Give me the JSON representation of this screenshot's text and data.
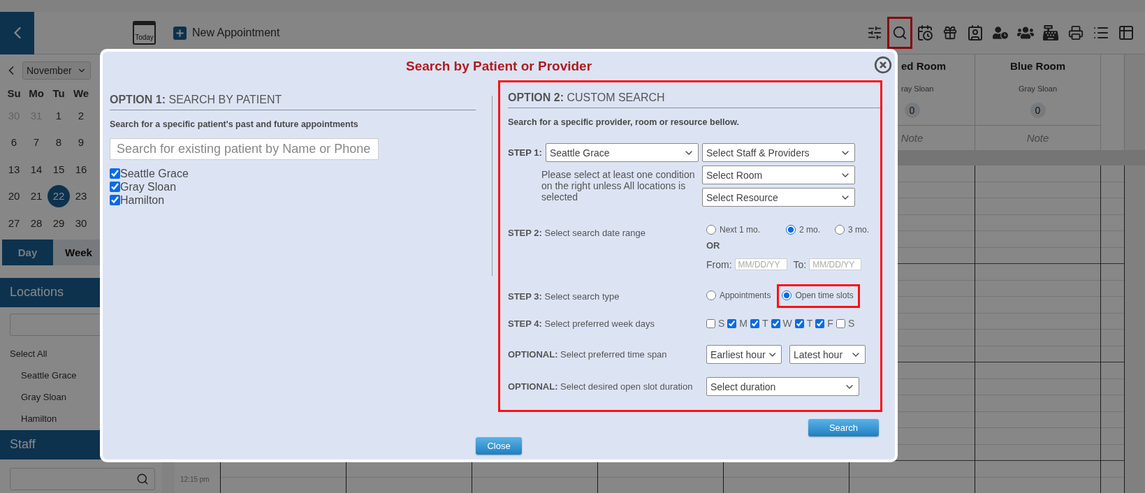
{
  "header": {
    "today": "Today",
    "new_appointment": "New Appointment",
    "toolbar": [
      {
        "kind": "filters",
        "highlighted": false
      },
      {
        "kind": "search",
        "highlighted": true
      },
      {
        "kind": "calendar",
        "highlighted": false
      },
      {
        "kind": "gift",
        "highlighted": false
      },
      {
        "kind": "contacts",
        "highlighted": false
      },
      {
        "kind": "waitlist",
        "highlighted": false
      },
      {
        "kind": "groups",
        "highlighted": false
      },
      {
        "kind": "register",
        "highlighted": false
      },
      {
        "kind": "print",
        "highlighted": false
      },
      {
        "kind": "list",
        "highlighted": false
      },
      {
        "kind": "table",
        "highlighted": false
      }
    ]
  },
  "sidebar": {
    "month": "November",
    "weekdays": [
      "Su",
      "Mo",
      "Tu",
      "We"
    ],
    "weeks": [
      [
        {
          "day": "30",
          "outside": true,
          "selected": false
        },
        {
          "day": "31",
          "outside": true,
          "selected": false
        },
        {
          "day": "1",
          "outside": false,
          "selected": false
        },
        {
          "day": "2",
          "outside": false,
          "selected": false
        }
      ],
      [
        {
          "day": "6",
          "outside": false,
          "selected": false
        },
        {
          "day": "7",
          "outside": false,
          "selected": false
        },
        {
          "day": "8",
          "outside": false,
          "selected": false
        },
        {
          "day": "9",
          "outside": false,
          "selected": false
        }
      ],
      [
        {
          "day": "13",
          "outside": false,
          "selected": false
        },
        {
          "day": "14",
          "outside": false,
          "selected": false
        },
        {
          "day": "15",
          "outside": false,
          "selected": false
        },
        {
          "day": "16",
          "outside": false,
          "selected": false
        }
      ],
      [
        {
          "day": "20",
          "outside": false,
          "selected": false
        },
        {
          "day": "21",
          "outside": false,
          "selected": false
        },
        {
          "day": "22",
          "outside": false,
          "selected": true
        },
        {
          "day": "23",
          "outside": false,
          "selected": false
        }
      ],
      [
        {
          "day": "27",
          "outside": false,
          "selected": false
        },
        {
          "day": "28",
          "outside": false,
          "selected": false
        },
        {
          "day": "29",
          "outside": false,
          "selected": false
        },
        {
          "day": "30",
          "outside": false,
          "selected": false
        }
      ]
    ],
    "view_tabs": [
      {
        "label": "Day",
        "selected": true
      },
      {
        "label": "Week",
        "selected": false
      }
    ],
    "locations": {
      "title": "Locations",
      "select_all": "Select All",
      "items": [
        "Seattle Grace",
        "Gray Sloan",
        "Hamilton"
      ]
    },
    "staff": {
      "title": "Staff"
    }
  },
  "calendar": {
    "columns": [
      {
        "room": "ed Room",
        "provider": "ray Sloan",
        "count": "0",
        "note": "Note"
      },
      {
        "room": "Blue Room",
        "provider": "Gray Sloan",
        "count": "0",
        "note": "Note"
      }
    ],
    "time_label": "12:15 pm"
  },
  "dialog": {
    "title": "Search by Patient or Provider",
    "option1": {
      "heading": "**OPTION 1:** SEARCH BY PATIENT",
      "description": "Search for a specific patient's past and future appointments",
      "search": {
        "placeholder": "Search for existing patient by Name or Phone"
      },
      "locations": [
        {
          "label": "Seattle Grace",
          "checked": true
        },
        {
          "label": "Gray Sloan",
          "checked": true
        },
        {
          "label": "Hamilton",
          "checked": true
        }
      ]
    },
    "option2": {
      "highlighted": true,
      "heading": "**OPTION 2:** CUSTOM SEARCH",
      "description": "Search for a specific provider, room or resource bellow.",
      "step1": {
        "label": "STEP 1:",
        "location": "Seattle Grace",
        "note": "Please select at least one condition on the right unless All locations is selected",
        "filters": [
          "Select Staff & Providers",
          "Select Room",
          "Select Resource"
        ]
      },
      "step2": {
        "label": "**STEP 2:** Select search date range",
        "ranges": [
          {
            "label": "Next 1 mo.",
            "selected": false
          },
          {
            "label": "2 mo.",
            "selected": true
          },
          {
            "label": "3 mo.",
            "selected": false
          }
        ],
        "or": "OR",
        "from": {
          "label": "From:",
          "placeholder": "MM/DD/YY"
        },
        "to": {
          "label": "To:",
          "placeholder": "MM/DD/YY"
        }
      },
      "step3": {
        "label": "**STEP 3:** Select search type",
        "types": [
          {
            "label": "Appointments",
            "selected": false,
            "highlighted": false
          },
          {
            "label": "Open time slots",
            "selected": true,
            "highlighted": true
          }
        ]
      },
      "step4": {
        "label": "**STEP 4:** Select preferred week days",
        "days": [
          {
            "label": "S",
            "checked": false
          },
          {
            "label": "M",
            "checked": true
          },
          {
            "label": "T",
            "checked": true
          },
          {
            "label": "W",
            "checked": true
          },
          {
            "label": "T",
            "checked": true
          },
          {
            "label": "F",
            "checked": true
          },
          {
            "label": "S",
            "checked": false
          }
        ]
      },
      "time_span": {
        "label": "**OPTIONAL:** Select preferred time span",
        "earliest": "Earliest hour",
        "latest": "Latest hour"
      },
      "duration": {
        "label": "**OPTIONAL:** Select desired open slot duration",
        "value": "Select duration"
      }
    },
    "buttons": {
      "search": "Search",
      "close": "Close"
    }
  }
}
